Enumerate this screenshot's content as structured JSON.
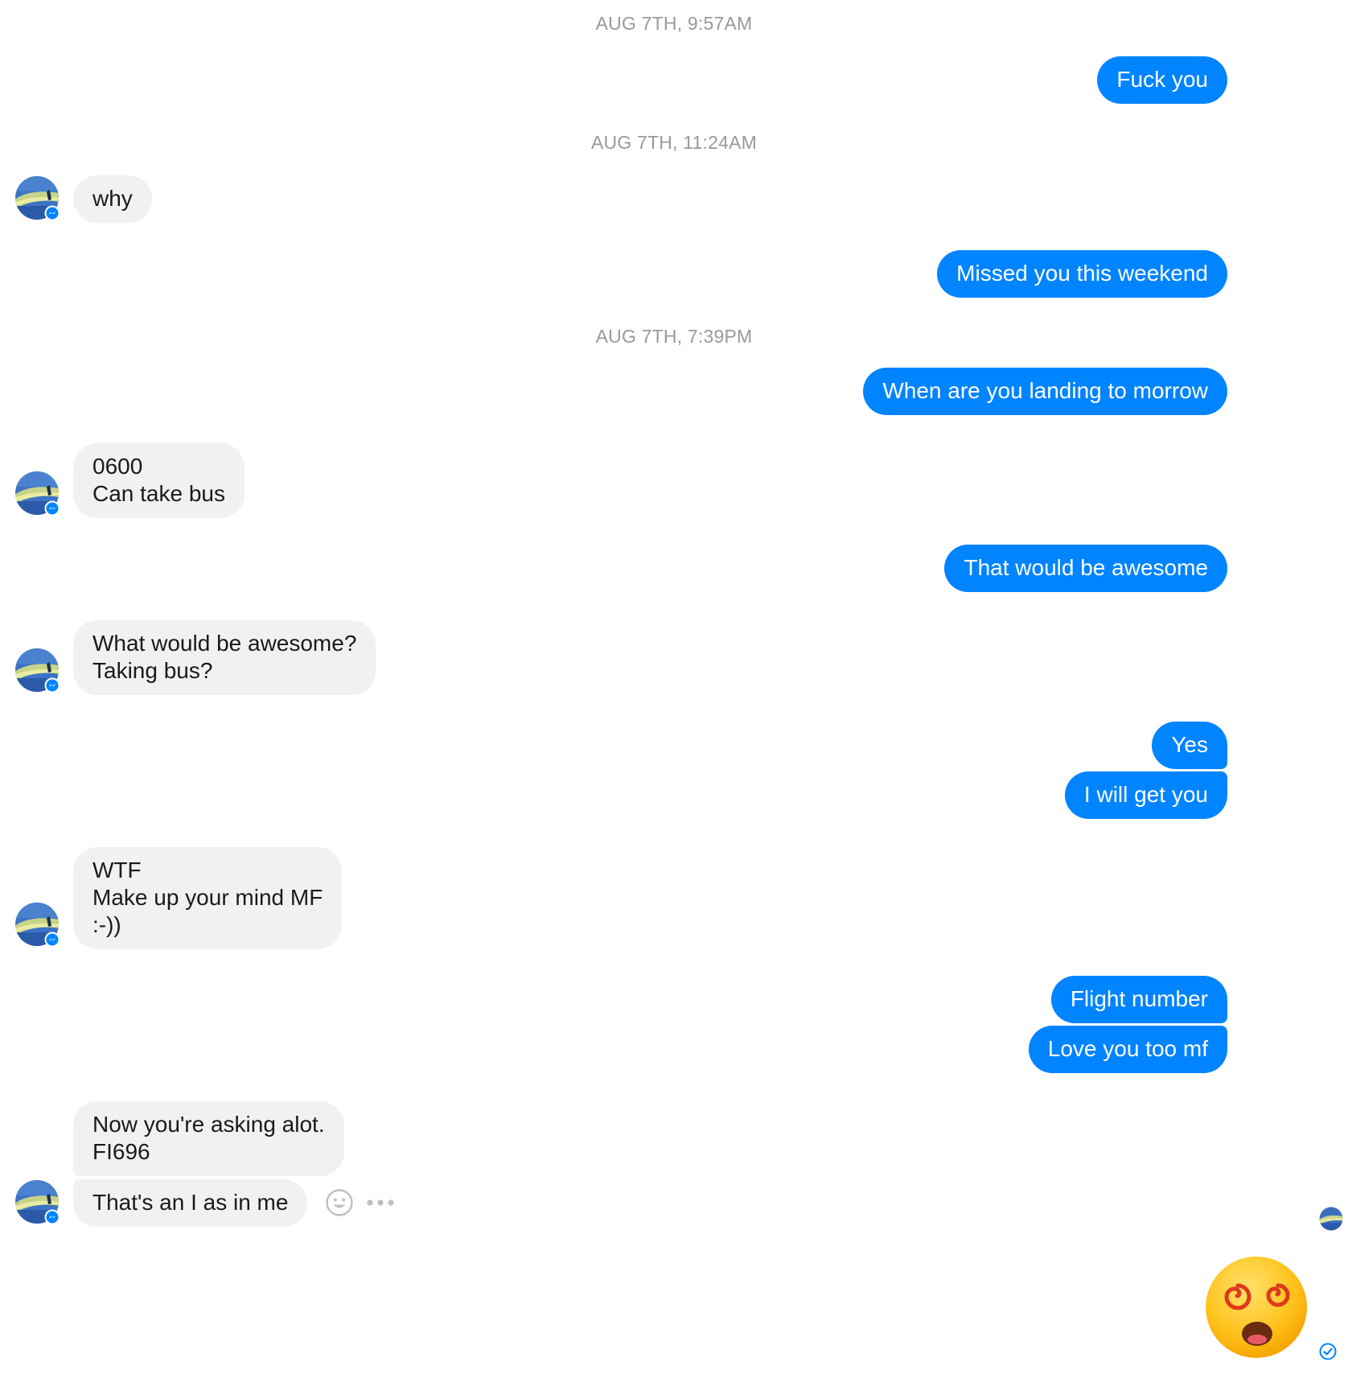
{
  "timestamps": [
    "AUG 7TH, 9:57AM",
    "AUG 7TH, 11:24AM",
    "AUG 7TH, 7:39PM"
  ],
  "messages": {
    "m1": "Fuck you",
    "m2": "why",
    "m3": "Missed you this weekend",
    "m4": "When are you landing to morrow",
    "m5": "0600\nCan take bus",
    "m6": "That would be awesome",
    "m7": "What would be awesome?\nTaking bus?",
    "m8": "Yes",
    "m9": "I will get you",
    "m10": "WTF\nMake up your mind MF\n:-))",
    "m11": "Flight number",
    "m12": "Love you too mf",
    "m13": "Now you're asking alot.\nFI696",
    "m14": "That's an I as in me"
  },
  "icons": {
    "avatar": "contact-avatar",
    "badge": "messenger-badge-icon",
    "react": "smiley-icon",
    "more": "more-dots-icon",
    "reaction": "dizzy-face-emoji",
    "seen": "delivered-check-icon"
  },
  "colors": {
    "outgoing": "#0084ff",
    "incoming": "#f1f1f1",
    "timestamp": "#999999"
  }
}
